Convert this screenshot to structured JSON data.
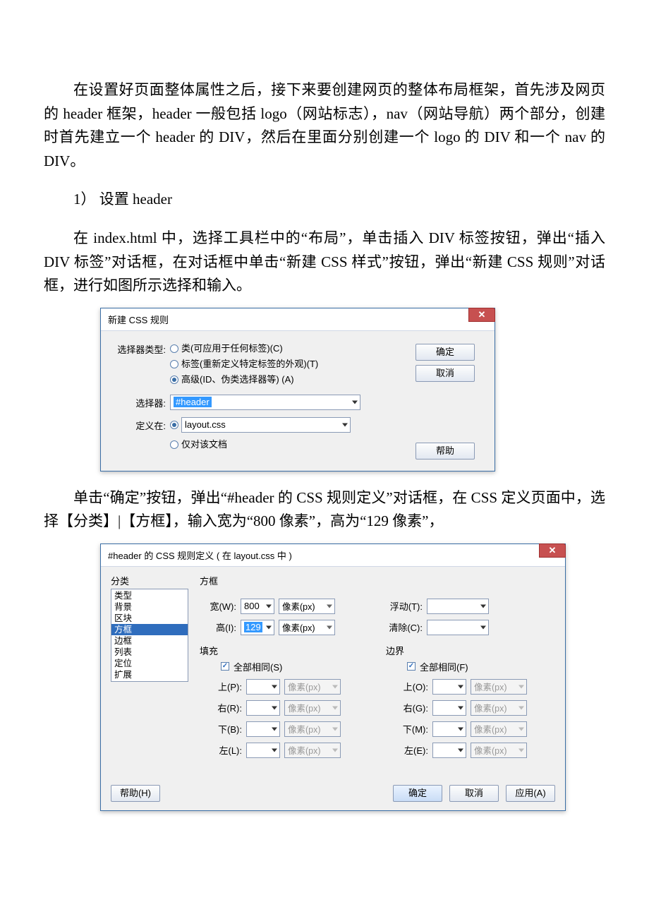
{
  "paras": {
    "p1": "在设置好页面整体属性之后，接下来要创建网页的整体布局框架，首先涉及网页的 header 框架，header 一般包括 logo（网站标志），nav（网站导航）两个部分，创建时首先建立一个 header 的 DIV，然后在里面分别创建一个 logo 的 DIV 和一个 nav 的 DIV。",
    "h1": "1） 设置 header",
    "p2": "在 index.html 中，选择工具栏中的“布局”，单击插入 DIV 标签按钮，弹出“插入 DIV 标签”对话框，在对话框中单击“新建 CSS 样式”按钮，弹出“新建 CSS 规则”对话框，进行如图所示选择和输入。",
    "p3": "单击“确定”按钮，弹出“#header 的 CSS 规则定义”对话框，在 CSS 定义页面中，选择【分类】|【方框】，输入宽为“800 像素”，高为“129 像素”，"
  },
  "dialog1": {
    "title": "新建 CSS 规则",
    "close": "✕",
    "rows": {
      "selector_type_label": "选择器类型:",
      "opt_class": "类(可应用于任何标签)(C)",
      "opt_tag": "标签(重新定义特定标签的外观)(T)",
      "opt_advanced": "高级(ID、伪类选择器等) (A)",
      "selector_label": "选择器:",
      "selector_value": "#header",
      "define_in_label": "定义在:",
      "define_file": "layout.css",
      "define_doc": "仅对该文档"
    },
    "buttons": {
      "ok": "确定",
      "cancel": "取消",
      "help": "帮助"
    }
  },
  "dialog2": {
    "title": "#header 的 CSS 规则定义 ( 在 layout.css 中 )",
    "close": "✕",
    "sidebar_head": "分类",
    "categories": [
      "类型",
      "背景",
      "区块",
      "方框",
      "边框",
      "列表",
      "定位",
      "扩展"
    ],
    "selected_cat": "方框",
    "section_title": "方框",
    "labels": {
      "width": "宽(W):",
      "height": "高(I):",
      "float": "浮动(T):",
      "clear": "清除(C):",
      "padding_head": "填充",
      "margin_head": "边界",
      "same_s": "全部相同(S)",
      "same_f": "全部相同(F)",
      "top_p": "上(P):",
      "right_r": "右(R):",
      "bottom_b": "下(B):",
      "left_l": "左(L):",
      "top_o": "上(O):",
      "right_g": "右(G):",
      "bottom_m": "下(M):",
      "left_e": "左(E):"
    },
    "values": {
      "width": "800",
      "height": "129",
      "unit": "像素(px)"
    },
    "buttons": {
      "help": "帮助(H)",
      "ok": "确定",
      "cancel": "取消",
      "apply": "应用(A)"
    }
  }
}
